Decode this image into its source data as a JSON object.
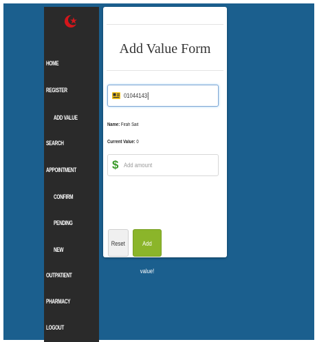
{
  "nav": {
    "items": [
      {
        "label": "HOME",
        "level": "top"
      },
      {
        "label": "REGISTER",
        "level": "top"
      },
      {
        "label": "ADD VALUE",
        "level": "sub"
      },
      {
        "label": "SEARCH",
        "level": "top"
      },
      {
        "label": "APPOINTMENT",
        "level": "top"
      },
      {
        "label": "CONFIRM",
        "level": "sub"
      },
      {
        "label": "PENDING",
        "level": "sub"
      },
      {
        "label": "NEW",
        "level": "sub"
      },
      {
        "label": "OUTPATIENT",
        "level": "top"
      },
      {
        "label": "PHARMACY",
        "level": "top"
      },
      {
        "label": "LOGOUT",
        "level": "top"
      }
    ]
  },
  "form": {
    "title": "Add Value Form",
    "id_field": {
      "value": "01044143",
      "icon": "id-card-icon"
    },
    "name_label": "Name:",
    "name_value": "Firah Sait",
    "current_label": "Current Value:",
    "current_value": "0",
    "amount_field": {
      "placeholder": "Add amount",
      "icon": "dollar-icon"
    },
    "reset_label": "Reset",
    "submit_label": "Add value!"
  },
  "colors": {
    "background": "#1b5f8e",
    "sidebar": "#2a2a2a",
    "submit": "#8bb52a",
    "logo": "#d4161b"
  }
}
